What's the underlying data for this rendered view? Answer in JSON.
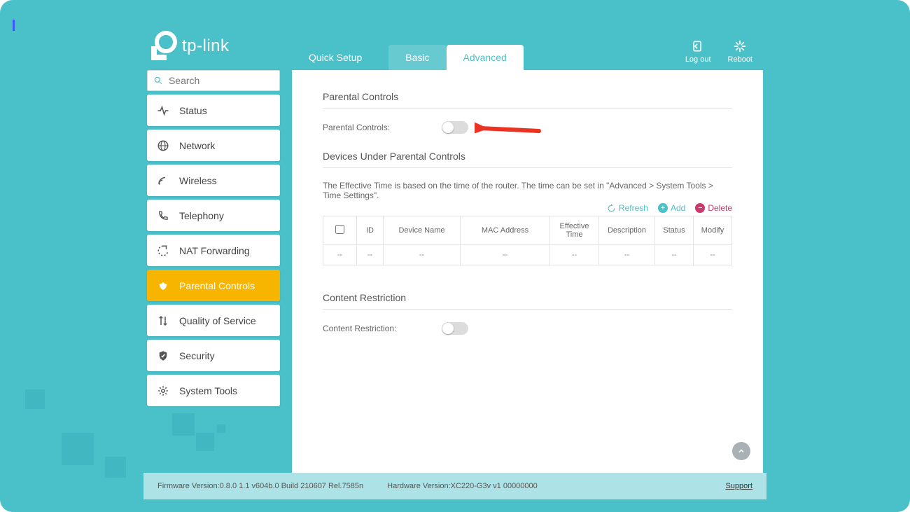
{
  "brand": {
    "name": "tp-link"
  },
  "tabs": {
    "quick": "Quick Setup",
    "basic": "Basic",
    "advanced": "Advanced"
  },
  "top_actions": {
    "logout": "Log out",
    "reboot": "Reboot"
  },
  "search": {
    "placeholder": "Search"
  },
  "sidebar": {
    "items": [
      {
        "label": "Status"
      },
      {
        "label": "Network"
      },
      {
        "label": "Wireless"
      },
      {
        "label": "Telephony"
      },
      {
        "label": "NAT Forwarding"
      },
      {
        "label": "Parental Controls"
      },
      {
        "label": "Quality of Service"
      },
      {
        "label": "Security"
      },
      {
        "label": "System Tools"
      }
    ]
  },
  "main": {
    "section1_title": "Parental Controls",
    "field1_label": "Parental Controls:",
    "section2_title": "Devices Under Parental Controls",
    "helper_text": "The Effective Time is based on the time of the router. The time can be set in \"Advanced > System Tools > Time Settings\".",
    "actions": {
      "refresh": "Refresh",
      "add": "Add",
      "delete": "Delete"
    },
    "table": {
      "headers": [
        "ID",
        "Device Name",
        "MAC Address",
        "Effective Time",
        "Description",
        "Status",
        "Modify"
      ],
      "empty_row": [
        "--",
        "--",
        "--",
        "--",
        "--",
        "--",
        "--",
        "--"
      ]
    },
    "section3_title": "Content Restriction",
    "field3_label": "Content Restriction:"
  },
  "footer": {
    "firmware": "Firmware Version:0.8.0 1.1 v604b.0 Build 210607 Rel.7585n",
    "hardware": "Hardware Version:XC220-G3v v1 00000000",
    "support": "Support"
  }
}
